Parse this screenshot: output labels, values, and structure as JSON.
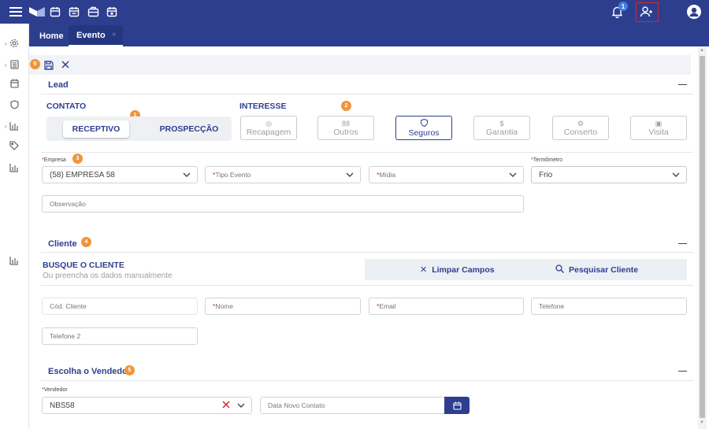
{
  "tabs": {
    "home": "Home",
    "evento": "Evento",
    "close": "×"
  },
  "notifications": {
    "count": "1"
  },
  "markers": [
    "1",
    "2",
    "3",
    "4",
    "5",
    "6"
  ],
  "lead": {
    "title": "Lead",
    "contato": {
      "label": "CONTATO",
      "options": [
        "RECEPTIVO",
        "PROSPECÇÃO"
      ],
      "selected": "RECEPTIVO"
    },
    "interesse": {
      "label": "INTERESSE",
      "options": [
        {
          "label": "Recapagem",
          "icon": "tire-icon"
        },
        {
          "label": "Outros",
          "icon": "grid-icon"
        },
        {
          "label": "Seguros",
          "icon": "shield-icon"
        },
        {
          "label": "Garantia",
          "icon": "dollar-icon"
        },
        {
          "label": "Conserto",
          "icon": "gear-icon"
        },
        {
          "label": "Visita",
          "icon": "id-card-icon"
        }
      ],
      "selected": "Seguros"
    },
    "empresa": {
      "label": "Empresa",
      "value": "(58) EMPRESA 58"
    },
    "tipo_evento": {
      "placeholder": "Tipo Evento"
    },
    "midia": {
      "placeholder": "Mídia"
    },
    "termometro": {
      "label": "Termômetro",
      "value": "Frio"
    },
    "observacao": {
      "placeholder": "Observação"
    }
  },
  "cliente": {
    "title": "Cliente",
    "busque": "BUSQUE O CLIENTE",
    "hint": "Ou preencha os dados manualmente",
    "limpar": "Limpar Campos",
    "pesquisar": "Pesquisar Cliente",
    "cod_cliente": "Cód. Cliente",
    "nome": "Nome",
    "email": "Email",
    "telefone": "Telefone",
    "telefone2": "Telefone 2"
  },
  "vendedor": {
    "title": "Escolha o Vendedor",
    "label": "Vendedor",
    "value": "NBS58",
    "data_contato": "Data Novo Contato"
  },
  "colors": {
    "primary": "#2d3e8f",
    "accent": "#f0953a",
    "danger": "#d42a2a"
  }
}
